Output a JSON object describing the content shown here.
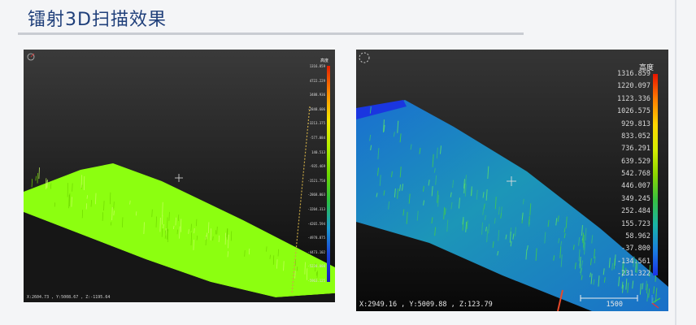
{
  "header": {
    "title": "镭射3D扫描效果"
  },
  "viewer_left": {
    "legend_title": "高度",
    "coordinates": "X:2604.73 , Y:5008.67 , Z:-1195.64",
    "scale_ticks": [
      "1316.859",
      "4722.229",
      "3488.936",
      "-2848.606",
      "-3213.375",
      "-577.084",
      "140.513",
      "-935.469",
      "-1521.758",
      "-2868.003",
      "-3204.313",
      "-4265.594",
      "-4978.875",
      "-4473.102",
      "-5238.000",
      "-5963.125"
    ]
  },
  "viewer_right": {
    "legend_title": "高度",
    "coordinates": "X:2949.16 , Y:5009.88 , Z:123.79",
    "scale_bar_label": "1500",
    "scale_ticks": [
      "1316.859",
      "1220.097",
      "1123.336",
      "1026.575",
      "929.813",
      "833.052",
      "736.291",
      "639.529",
      "542.768",
      "446.007",
      "349.245",
      "252.484",
      "155.723",
      "58.962",
      "-37.800",
      "-134.561",
      "-231.322"
    ]
  },
  "colors": {
    "slide_background": "#f4f5f7",
    "title_color": "#1f3f7a",
    "left_surface": "#8cff10",
    "right_surface": "#1d8fc0"
  }
}
